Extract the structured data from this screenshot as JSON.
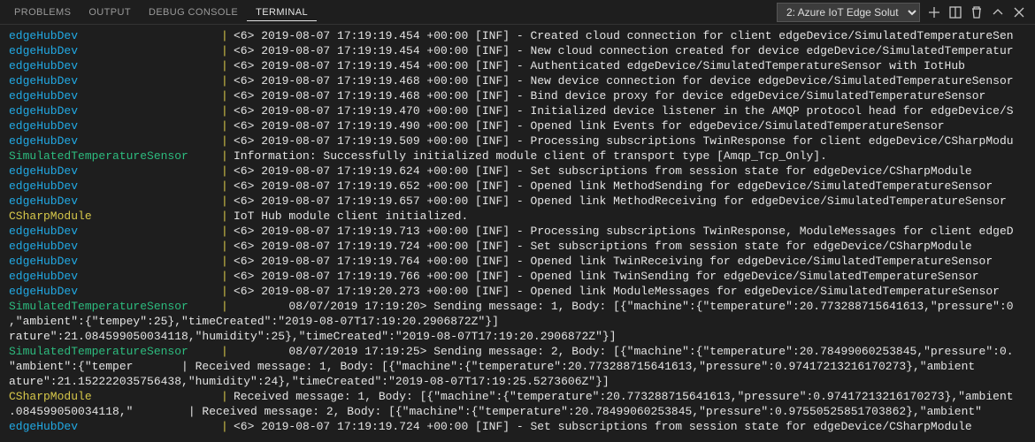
{
  "tabs": {
    "problems": "PROBLEMS",
    "output": "OUTPUT",
    "debug": "DEBUG CONSOLE",
    "terminal": "TERMINAL"
  },
  "terminal_select": "2: Azure IoT Edge Solut",
  "lines": [
    {
      "src": "edgeHubDev",
      "cls": "src-edgehub",
      "msg": "<6> 2019-08-07 17:19:19.454 +00:00 [INF] - Created cloud connection for client edgeDevice/SimulatedTemperatureSen"
    },
    {
      "src": "edgeHubDev",
      "cls": "src-edgehub",
      "msg": "<6> 2019-08-07 17:19:19.454 +00:00 [INF] - New cloud connection created for device edgeDevice/SimulatedTemperatur"
    },
    {
      "src": "edgeHubDev",
      "cls": "src-edgehub",
      "msg": "<6> 2019-08-07 17:19:19.454 +00:00 [INF] - Authenticated edgeDevice/SimulatedTemperatureSensor with IotHub"
    },
    {
      "src": "edgeHubDev",
      "cls": "src-edgehub",
      "msg": "<6> 2019-08-07 17:19:19.468 +00:00 [INF] - New device connection for device edgeDevice/SimulatedTemperatureSensor"
    },
    {
      "src": "edgeHubDev",
      "cls": "src-edgehub",
      "msg": "<6> 2019-08-07 17:19:19.468 +00:00 [INF] - Bind device proxy for device edgeDevice/SimulatedTemperatureSensor"
    },
    {
      "src": "edgeHubDev",
      "cls": "src-edgehub",
      "msg": "<6> 2019-08-07 17:19:19.470 +00:00 [INF] - Initialized device listener in the AMQP protocol head for edgeDevice/S"
    },
    {
      "src": "edgeHubDev",
      "cls": "src-edgehub",
      "msg": "<6> 2019-08-07 17:19:19.490 +00:00 [INF] - Opened link Events for edgeDevice/SimulatedTemperatureSensor"
    },
    {
      "src": "edgeHubDev",
      "cls": "src-edgehub",
      "msg": "<6> 2019-08-07 17:19:19.509 +00:00 [INF] - Processing subscriptions TwinResponse for client edgeDevice/CSharpModu"
    },
    {
      "src": "SimulatedTemperatureSensor",
      "cls": "src-sim",
      "msg": "Information: Successfully initialized module client of transport type [Amqp_Tcp_Only]."
    },
    {
      "src": "edgeHubDev",
      "cls": "src-edgehub",
      "msg": "<6> 2019-08-07 17:19:19.624 +00:00 [INF] - Set subscriptions from session state for edgeDevice/CSharpModule"
    },
    {
      "src": "edgeHubDev",
      "cls": "src-edgehub",
      "msg": "<6> 2019-08-07 17:19:19.652 +00:00 [INF] - Opened link MethodSending for edgeDevice/SimulatedTemperatureSensor"
    },
    {
      "src": "edgeHubDev",
      "cls": "src-edgehub",
      "msg": "<6> 2019-08-07 17:19:19.657 +00:00 [INF] - Opened link MethodReceiving for edgeDevice/SimulatedTemperatureSensor"
    },
    {
      "src": "CSharpModule",
      "cls": "src-csharp",
      "msg": "IoT Hub module client initialized."
    },
    {
      "src": "edgeHubDev",
      "cls": "src-edgehub",
      "msg": "<6> 2019-08-07 17:19:19.713 +00:00 [INF] - Processing subscriptions TwinResponse, ModuleMessages for client edgeD"
    },
    {
      "src": "edgeHubDev",
      "cls": "src-edgehub",
      "msg": "<6> 2019-08-07 17:19:19.724 +00:00 [INF] - Set subscriptions from session state for edgeDevice/CSharpModule"
    },
    {
      "src": "edgeHubDev",
      "cls": "src-edgehub",
      "msg": "<6> 2019-08-07 17:19:19.764 +00:00 [INF] - Opened link TwinReceiving for edgeDevice/SimulatedTemperatureSensor"
    },
    {
      "src": "edgeHubDev",
      "cls": "src-edgehub",
      "msg": "<6> 2019-08-07 17:19:19.766 +00:00 [INF] - Opened link TwinSending for edgeDevice/SimulatedTemperatureSensor"
    },
    {
      "src": "edgeHubDev",
      "cls": "src-edgehub",
      "msg": "<6> 2019-08-07 17:19:20.273 +00:00 [INF] - Opened link ModuleMessages for edgeDevice/SimulatedTemperatureSensor"
    },
    {
      "src": "SimulatedTemperatureSensor",
      "cls": "src-sim",
      "msg": "        08/07/2019 17:19:20> Sending message: 1, Body: [{\"machine\":{\"temperature\":20.773288715641613,\"pressure\":0"
    },
    {
      "wrap": ",\"ambient\":{\"tempey\":25},\"timeCreated\":\"2019-08-07T17:19:20.2906872Z\"}]"
    },
    {
      "wrap": "rature\":21.084599050034118,\"humidity\":25},\"timeCreated\":\"2019-08-07T17:19:20.2906872Z\"}]"
    },
    {
      "src": "SimulatedTemperatureSensor",
      "cls": "src-sim",
      "msg": "        08/07/2019 17:19:25> Sending message: 2, Body: [{\"machine\":{\"temperature\":20.78499060253845,\"pressure\":0."
    },
    {
      "wrap": "\"ambient\":{\"temper       | Received message: 1, Body: [{\"machine\":{\"temperature\":20.773288715641613,\"pressure\":0.97417213216170273},\"ambient"
    },
    {
      "wrap": "ature\":21.152222035756438,\"humidity\":24},\"timeCreated\":\"2019-08-07T17:19:25.5273606Z\"}]"
    },
    {
      "src": "CSharpModule",
      "cls": "src-csharp",
      "msg": "Received message: 1, Body: [{\"machine\":{\"temperature\":20.773288715641613,\"pressure\":0.97417213216170273},\"ambient"
    },
    {
      "wrap": ".084599050034118,\"        | Received message: 2, Body: [{\"machine\":{\"temperature\":20.78499060253845,\"pressure\":0.97550525851703862},\"ambient\""
    },
    {
      "src": "edgeHubDev",
      "cls": "src-edgehub",
      "msg": "<6> 2019-08-07 17:19:19.724 +00:00 [INF] - Set subscriptions from session state for edgeDevice/CSharpModule"
    }
  ]
}
